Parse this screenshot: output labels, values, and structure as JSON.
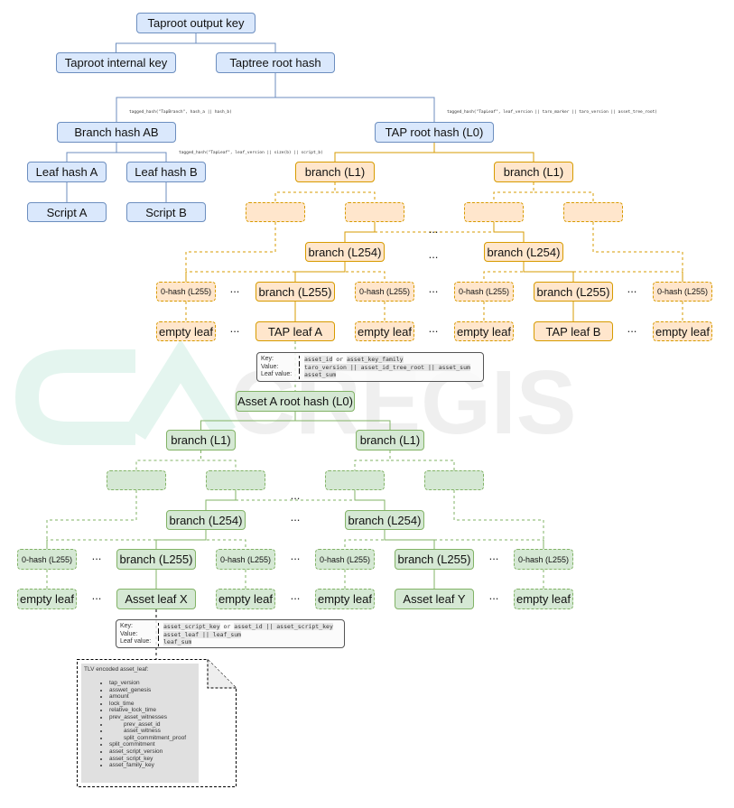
{
  "logo": {
    "text": "CREGIS"
  },
  "colors": {
    "blue_fill": "#dae8fc",
    "blue_stroke": "#6c8ebf",
    "orange_fill": "#ffe6cc",
    "orange_stroke": "#d79b00",
    "green_fill": "#d5e8d4",
    "green_stroke": "#82b366"
  },
  "nodes": {
    "out": "Taproot output key",
    "internal": "Taproot internal key",
    "taptree": "Taptree root hash",
    "bab": "Branch hash AB",
    "taproot": "TAP root hash (L0)",
    "lha": "Leaf hash A",
    "lhb": "Leaf hash B",
    "sa": "Script A",
    "sb": "Script B",
    "o_l1a": "branch (L1)",
    "o_l1b": "branch (L1)",
    "o_l254a": "branch (L254)",
    "o_l254b": "branch (L254)",
    "o_z1": "0-hash (L255)",
    "o_b255a": "branch (L255)",
    "o_z2": "0-hash (L255)",
    "o_z3": "0-hash (L255)",
    "o_b255b": "branch (L255)",
    "o_z4": "0-hash (L255)",
    "o_e1": "empty leaf",
    "o_la": "TAP leaf A",
    "o_e2": "empty leaf",
    "o_e3": "empty leaf",
    "o_lb": "TAP leaf B",
    "o_e4": "empty leaf",
    "g_root": "Asset A root hash (L0)",
    "g_l1a": "branch (L1)",
    "g_l1b": "branch (L1)",
    "g_l254a": "branch (L254)",
    "g_l254b": "branch (L254)",
    "g_z1": "0-hash (L255)",
    "g_b255a": "branch (L255)",
    "g_z2": "0-hash (L255)",
    "g_z3": "0-hash (L255)",
    "g_b255b": "branch (L255)",
    "g_z4": "0-hash (L255)",
    "g_e1": "empty leaf",
    "g_lx": "Asset leaf X",
    "g_e2": "empty leaf",
    "g_e3": "empty leaf",
    "g_ly": "Asset leaf Y",
    "g_e4": "empty leaf"
  },
  "ellipsis": "...",
  "annotations": {
    "tapbranch": "tagged_hash(\"TapBranch\", hash_a || hash_b)",
    "tapleaf_taro": "tagged_hash(\"TapLeaf\", leaf_version || taro_marker || taro_version || asset_tree_root)",
    "tapleaf_script": "tagged_hash(\"TapLeaf\", leaf_version || size(b) || script_b)"
  },
  "kv_tap": {
    "key_label": "Key:",
    "value_label": "Value:",
    "leaf_label": "Leaf value:",
    "key_a": "asset_id",
    "key_or": "or",
    "key_b": "asset_key_family",
    "value": "taro_version || asset_id_tree_root || asset_sum",
    "leaf": "asset_sum"
  },
  "kv_asset": {
    "key_label": "Key:",
    "value_label": "Value:",
    "leaf_label": "Leaf value:",
    "key_a": "asset_script_key",
    "key_or": "or",
    "key_b": "asset_id || asset_script_key",
    "value": "asset_leaf || leaf_sum",
    "leaf": "leaf_sum"
  },
  "tlv": {
    "title": "TLV encoded asset_leaf:",
    "items": [
      "tap_version",
      "asswet_genesis",
      "amount",
      "lock_time",
      "relative_lock_time",
      "prev_asset_witnesses",
      "prev_asset_id",
      "asset_witness",
      "split_commitment_proof",
      "split_commitment",
      "asset_script_version",
      "asset_script_key",
      "asset_family_key"
    ]
  }
}
